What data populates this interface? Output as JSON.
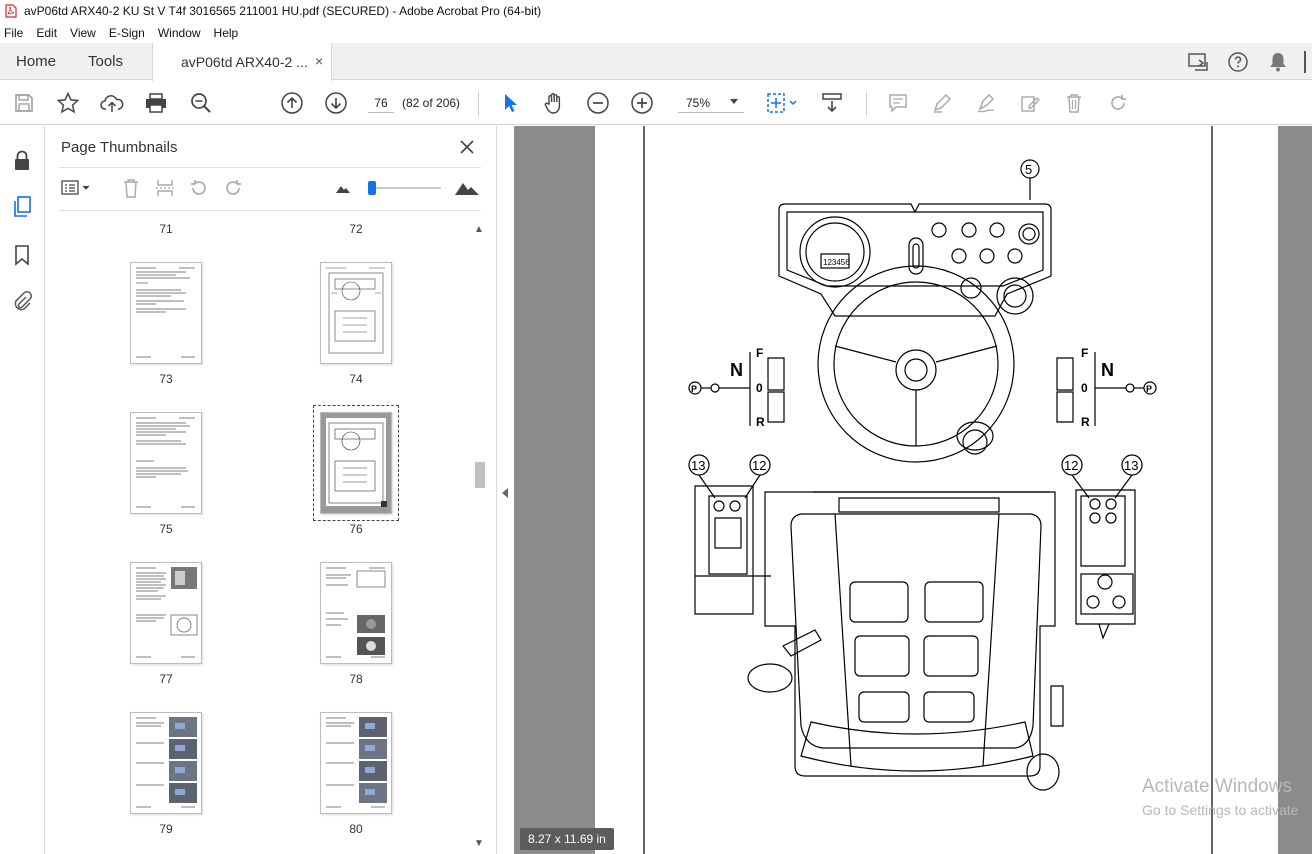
{
  "window": {
    "title": "avP06td ARX40-2 KU St V T4f 3016565 211001 HU.pdf (SECURED) - Adobe Acrobat Pro (64-bit)"
  },
  "menu": [
    "File",
    "Edit",
    "View",
    "E-Sign",
    "Window",
    "Help"
  ],
  "tabs": {
    "home": "Home",
    "tools": "Tools",
    "doc": "avP06td ARX40-2 ...",
    "close": "×"
  },
  "toolbar": {
    "page_value": "76",
    "page_count": "(82 of 206)",
    "zoom": "75%"
  },
  "panel": {
    "title": "Page Thumbnails",
    "close": "✕",
    "page_labels": [
      "71",
      "72",
      "73",
      "74",
      "75",
      "76",
      "77",
      "78",
      "79",
      "80"
    ],
    "selected_page": "76"
  },
  "document": {
    "page_size": "8.27 x 11.69 in",
    "callouts": [
      "5",
      "13",
      "12",
      "12",
      "13"
    ],
    "shift_labels": {
      "n": "N",
      "f": "F",
      "zero": "0",
      "r": "R",
      "p": "P"
    },
    "display_text": "123456"
  },
  "watermark": {
    "line1": "Activate Windows",
    "line2": "Go to Settings to activate"
  }
}
